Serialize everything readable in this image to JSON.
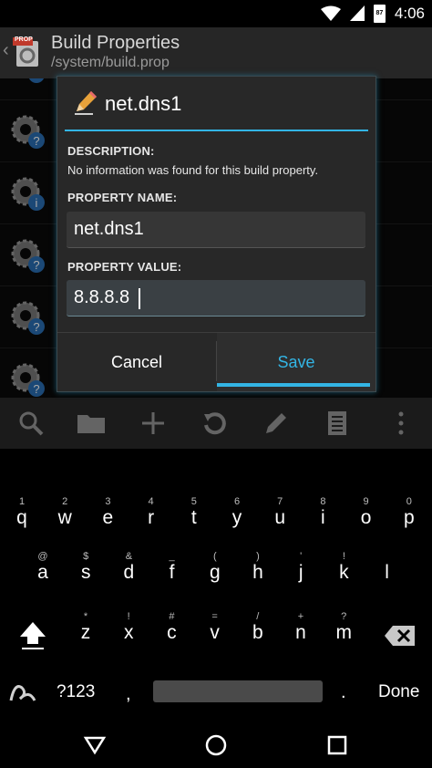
{
  "status_bar": {
    "time": "4:06",
    "battery_level": "87"
  },
  "header": {
    "title": "Build Properties",
    "subtitle": "/system/build.prop",
    "app_icon_text": "PROP"
  },
  "dialog": {
    "title": "net.dns1",
    "description_label": "DESCRIPTION:",
    "description_text": "No information was found for this build property.",
    "property_name_label": "PROPERTY NAME:",
    "property_name_value": "net.dns1",
    "property_value_label": "PROPERTY VALUE:",
    "property_value_value": "8.8.8.8",
    "cancel_label": "Cancel",
    "save_label": "Save"
  },
  "toolbar": {
    "icons": [
      "search-icon",
      "folder-icon",
      "add-icon",
      "restore-icon",
      "edit-icon",
      "document-icon",
      "overflow-menu-icon"
    ]
  },
  "keyboard": {
    "row1": [
      {
        "hint": "1",
        "key": "q"
      },
      {
        "hint": "2",
        "key": "w"
      },
      {
        "hint": "3",
        "key": "e"
      },
      {
        "hint": "4",
        "key": "r"
      },
      {
        "hint": "5",
        "key": "t"
      },
      {
        "hint": "6",
        "key": "y"
      },
      {
        "hint": "7",
        "key": "u"
      },
      {
        "hint": "8",
        "key": "i"
      },
      {
        "hint": "9",
        "key": "o"
      },
      {
        "hint": "0",
        "key": "p"
      }
    ],
    "row2": [
      {
        "hint": "@",
        "key": "a"
      },
      {
        "hint": "$",
        "key": "s"
      },
      {
        "hint": "&",
        "key": "d"
      },
      {
        "hint": "_",
        "key": "f"
      },
      {
        "hint": "(",
        "key": "g"
      },
      {
        "hint": ")",
        "key": "h"
      },
      {
        "hint": "'",
        "key": "j"
      },
      {
        "hint": "!",
        "key": "k"
      },
      {
        "hint": "",
        "key": "l"
      }
    ],
    "row3": [
      {
        "hint": "*",
        "key": "z"
      },
      {
        "hint": "!",
        "key": "x"
      },
      {
        "hint": "#",
        "key": "c"
      },
      {
        "hint": "=",
        "key": "v"
      },
      {
        "hint": "/",
        "key": "b"
      },
      {
        "hint": "+",
        "key": "n"
      },
      {
        "hint": "?",
        "key": "m"
      }
    ],
    "symbols_label": "?123",
    "comma": ",",
    "period": ".",
    "done_label": "Done"
  },
  "colors": {
    "accent": "#33b5e5",
    "dialog_bg": "#282828",
    "toolbar_bg": "#2a2a2a",
    "header_bg": "#262626"
  }
}
